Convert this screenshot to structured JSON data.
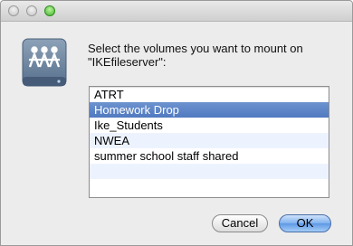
{
  "window": {
    "controls": {
      "close_icon": "close-light-icon",
      "minimize_icon": "minimize-light-icon",
      "zoom_icon": "zoom-light-icon",
      "zoom_color": "#3fb52d"
    }
  },
  "dialog": {
    "icon": "network-drive-icon",
    "prompt_line1": "Select the volumes you want to mount on",
    "prompt_line2": "\"IKEfileserver\":",
    "volumes": [
      {
        "label": "ATRT",
        "selected": false
      },
      {
        "label": "Homework Drop",
        "selected": true
      },
      {
        "label": "Ike_Students",
        "selected": false
      },
      {
        "label": "NWEA",
        "selected": false
      },
      {
        "label": "summer school staff shared",
        "selected": false
      }
    ],
    "selection_color": "#5a82c6",
    "buttons": {
      "cancel_label": "Cancel",
      "ok_label": "OK"
    }
  }
}
